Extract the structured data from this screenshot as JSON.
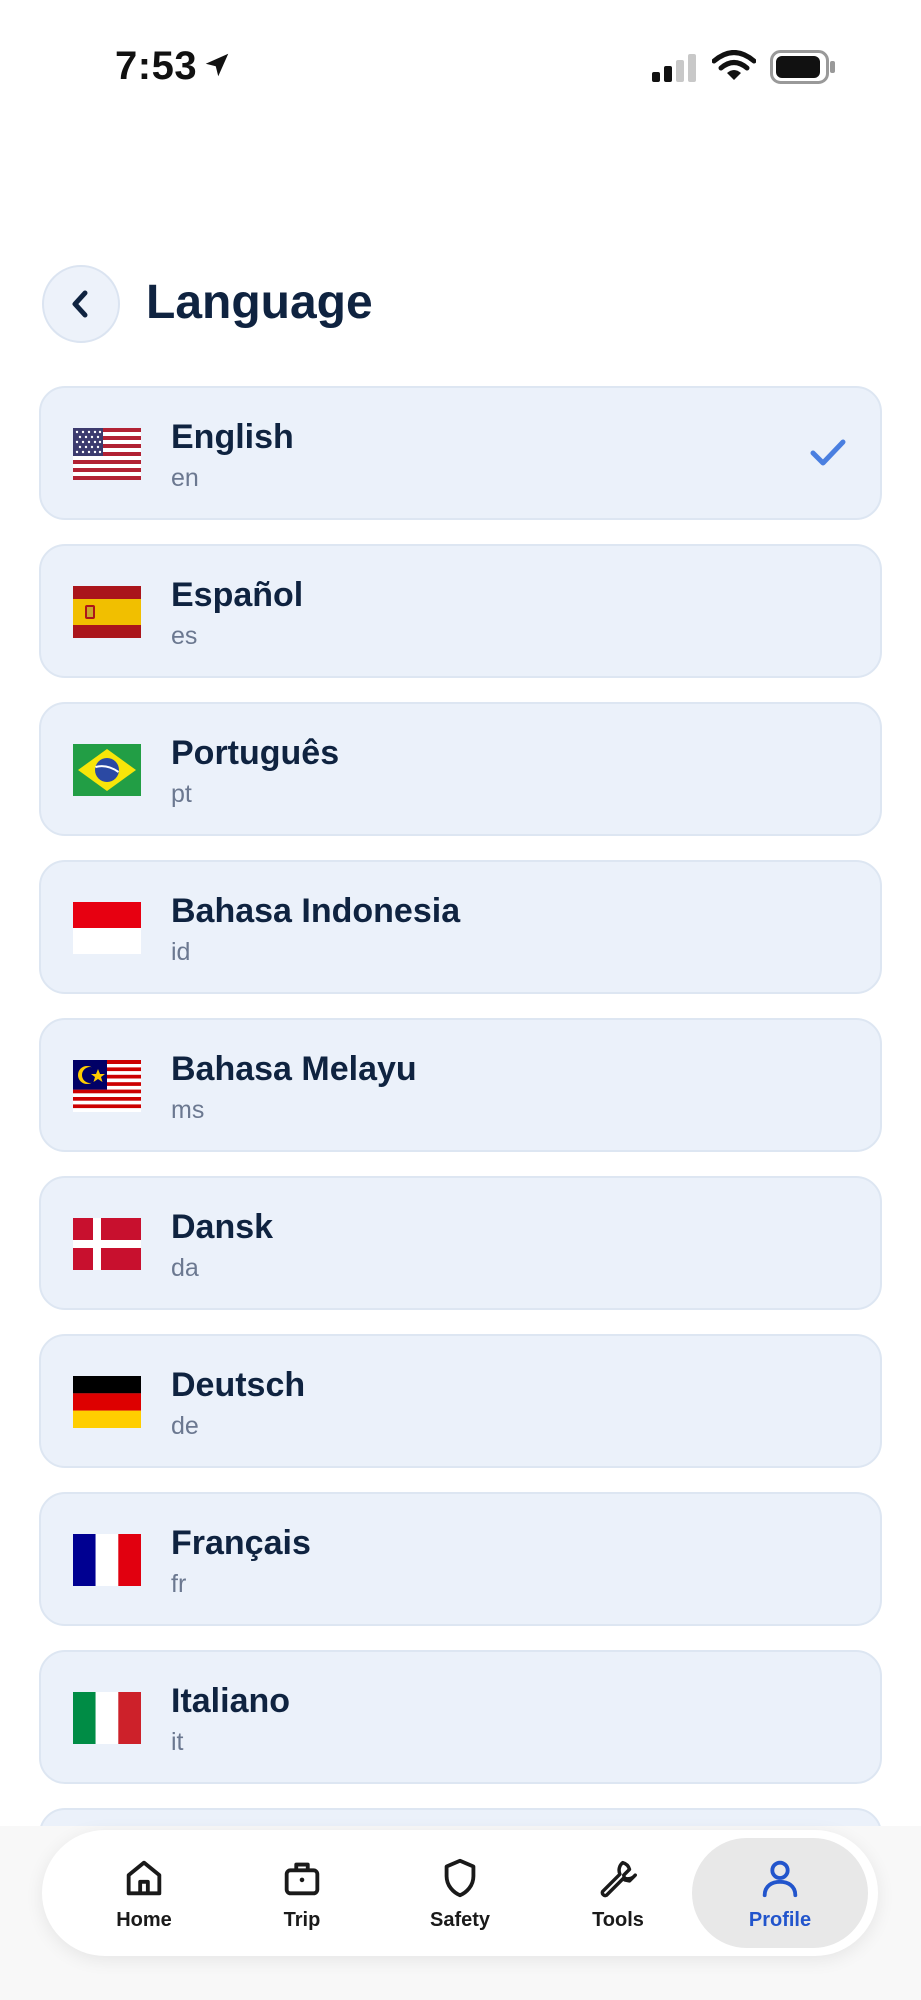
{
  "status_bar": {
    "time": "7:53"
  },
  "header": {
    "title": "Language"
  },
  "languages": [
    {
      "name": "English",
      "code": "en",
      "flag": "us-flag",
      "selected": true
    },
    {
      "name": "Español",
      "code": "es",
      "flag": "es-flag",
      "selected": false
    },
    {
      "name": "Português",
      "code": "pt",
      "flag": "br-flag",
      "selected": false
    },
    {
      "name": "Bahasa Indonesia",
      "code": "id",
      "flag": "id-flag",
      "selected": false
    },
    {
      "name": "Bahasa Melayu",
      "code": "ms",
      "flag": "my-flag",
      "selected": false
    },
    {
      "name": "Dansk",
      "code": "da",
      "flag": "dk-flag",
      "selected": false
    },
    {
      "name": "Deutsch",
      "code": "de",
      "flag": "de-flag",
      "selected": false
    },
    {
      "name": "Français",
      "code": "fr",
      "flag": "fr-flag",
      "selected": false
    },
    {
      "name": "Italiano",
      "code": "it",
      "flag": "it-flag",
      "selected": false
    }
  ],
  "tabbar": {
    "items": [
      {
        "label": "Home",
        "icon": "home-icon",
        "active": false
      },
      {
        "label": "Trip",
        "icon": "briefcase-icon",
        "active": false
      },
      {
        "label": "Safety",
        "icon": "shield-icon",
        "active": false
      },
      {
        "label": "Tools",
        "icon": "wrench-icon",
        "active": false
      },
      {
        "label": "Profile",
        "icon": "user-icon",
        "active": true
      }
    ]
  },
  "colors": {
    "accent": "#2255cc",
    "check": "#4a7fe0",
    "row_bg": "#ebf1fa",
    "title": "#0f2340"
  }
}
